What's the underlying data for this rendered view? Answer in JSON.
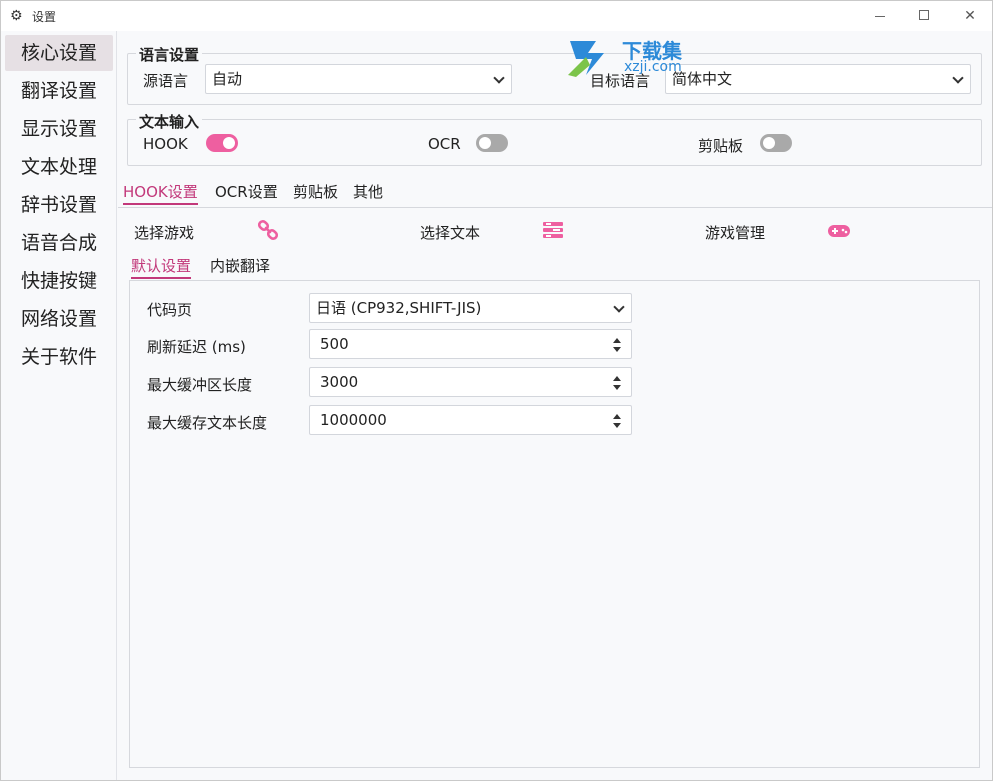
{
  "window": {
    "title": "设置"
  },
  "sidebar": {
    "items": [
      {
        "label": "核心设置",
        "active": true
      },
      {
        "label": "翻译设置"
      },
      {
        "label": "显示设置"
      },
      {
        "label": "文本处理"
      },
      {
        "label": "辞书设置"
      },
      {
        "label": "语音合成"
      },
      {
        "label": "快捷按键"
      },
      {
        "label": "网络设置"
      },
      {
        "label": "关于软件"
      }
    ]
  },
  "language": {
    "group_title": "语言设置",
    "source_label": "源语言",
    "source_value": "自动",
    "target_label": "目标语言",
    "target_value": "简体中文"
  },
  "text_input": {
    "group_title": "文本输入",
    "hook_label": "HOOK",
    "hook_on": true,
    "ocr_label": "OCR",
    "ocr_on": false,
    "clipboard_label": "剪贴板",
    "clipboard_on": false
  },
  "tabs": [
    "HOOK设置",
    "OCR设置",
    "剪贴板",
    "其他"
  ],
  "hook": {
    "select_game": "选择游戏",
    "select_text": "选择文本",
    "game_manage": "游戏管理",
    "subtabs": [
      "默认设置",
      "内嵌翻译"
    ],
    "fields": {
      "codepage_label": "代码页",
      "codepage_value": "日语 (CP932,SHIFT-JIS)",
      "refresh_label": "刷新延迟 (ms)",
      "refresh_value": "500",
      "buffer_label": "最大缓冲区长度",
      "buffer_value": "3000",
      "cache_label": "最大缓存文本长度",
      "cache_value": "1000000"
    }
  },
  "watermark": {
    "text": "下载集",
    "url": "xzji.com"
  },
  "colors": {
    "accent": "#ee5fa0",
    "tab_active": "#c2387a"
  }
}
